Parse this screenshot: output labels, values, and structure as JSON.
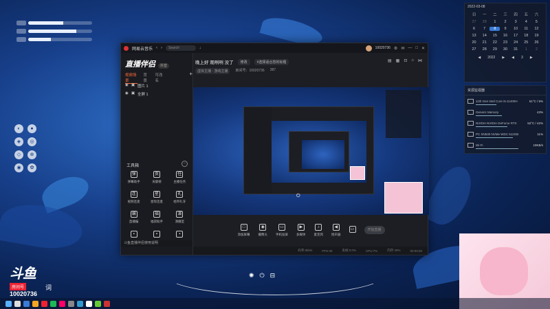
{
  "widget": {
    "rows": [
      {
        "tag": "",
        "fill": 0.55
      },
      {
        "tag": "",
        "fill": 0.75
      },
      {
        "tag": "",
        "fill": 0.35
      }
    ]
  },
  "window": {
    "app_name": "网易云音乐",
    "search_placeholder": "Search",
    "user_id": "10020736"
  },
  "sidebar": {
    "logo": "直播伴侣",
    "logo_badge": "抖音",
    "tabs": [
      "视频场景",
      "背景",
      "可改名"
    ],
    "sources": [
      "图片 1",
      "全屏 1"
    ],
    "tools_title": "工具箱",
    "tools": [
      {
        "label": "弹幕助手",
        "icon": "弹"
      },
      {
        "label": "贡献榜",
        "icon": "贡"
      },
      {
        "label": "主播任务",
        "icon": "任"
      },
      {
        "label": "视频连麦",
        "icon": "连"
      },
      {
        "label": "星际连麦",
        "icon": "星"
      },
      {
        "label": "给带礼牙",
        "icon": "礼"
      },
      {
        "label": "直播编",
        "icon": "编"
      },
      {
        "label": "福袋助手",
        "icon": "福"
      },
      {
        "label": "演播室",
        "icon": "演"
      },
      {
        "label": "",
        "icon": "▪"
      },
      {
        "label": "",
        "icon": "▪"
      },
      {
        "label": "",
        "icon": "▪"
      }
    ],
    "notice": "斗鱼直播伴侣使用说明"
  },
  "room": {
    "title": "晚上好 观咧咧 没了",
    "chip1": "修改",
    "chip2": "#选择适合您的标题",
    "category": "虚拟主播 · 游戏主播",
    "room_label": "房间号：",
    "room_no": "10020736",
    "fans": "387"
  },
  "bottom_tools": [
    {
      "label": "添加屏幕",
      "icon": "□"
    },
    {
      "label": "摄像头",
      "icon": "◉"
    },
    {
      "label": "手机投屏",
      "icon": "▭"
    },
    {
      "label": "多媒体",
      "icon": "▶"
    },
    {
      "label": "麦克风",
      "icon": "♪"
    },
    {
      "label": "扬声器",
      "icon": "◀"
    },
    {
      "label": "",
      "icon": "▭"
    }
  ],
  "go_live": "开始直播",
  "status": [
    "码率:0kb/s",
    "FPS:30",
    "丢帧:0.0%",
    "CPU:7%",
    "内存:40%",
    "00:00:00"
  ],
  "calendar": {
    "date": "2022-03-08",
    "weekdays": [
      "日",
      "一",
      "二",
      "三",
      "四",
      "五",
      "六"
    ],
    "days": [
      {
        "d": "27",
        "dim": true
      },
      {
        "d": "28",
        "dim": true
      },
      {
        "d": "1"
      },
      {
        "d": "2"
      },
      {
        "d": "3"
      },
      {
        "d": "4"
      },
      {
        "d": "5"
      },
      {
        "d": "6"
      },
      {
        "d": "7"
      },
      {
        "d": "8",
        "today": true
      },
      {
        "d": "9"
      },
      {
        "d": "10"
      },
      {
        "d": "11"
      },
      {
        "d": "12"
      },
      {
        "d": "13"
      },
      {
        "d": "14"
      },
      {
        "d": "15"
      },
      {
        "d": "16"
      },
      {
        "d": "17"
      },
      {
        "d": "18"
      },
      {
        "d": "19"
      },
      {
        "d": "20"
      },
      {
        "d": "21"
      },
      {
        "d": "22"
      },
      {
        "d": "23"
      },
      {
        "d": "24"
      },
      {
        "d": "25"
      },
      {
        "d": "26"
      },
      {
        "d": "27"
      },
      {
        "d": "28"
      },
      {
        "d": "29"
      },
      {
        "d": "30"
      },
      {
        "d": "31"
      },
      {
        "d": "1",
        "dim": true
      },
      {
        "d": "2",
        "dim": true
      }
    ],
    "year": "2022",
    "month": "3"
  },
  "monitor": {
    "title": "资源监视器",
    "rows": [
      {
        "name": "11th Gen Intel Core i5-11400H",
        "val": "51°C / 5%"
      },
      {
        "name": "Generic Memory",
        "val": "43%"
      },
      {
        "name": "NVIDIA NVIDIA GeForce RTX",
        "val": "52°C / 42%"
      },
      {
        "name": "PC SN530 NVMe WDC 512GB",
        "val": "11%"
      },
      {
        "name": "Wi-Fi",
        "val": "19KB/s"
      }
    ]
  },
  "brand": {
    "logo": "斗鱼",
    "tag": "房间号",
    "room": "10020736",
    "char": "词"
  },
  "colors": {
    "accent": "#ff6c3b",
    "today": "#3a7bd5"
  }
}
